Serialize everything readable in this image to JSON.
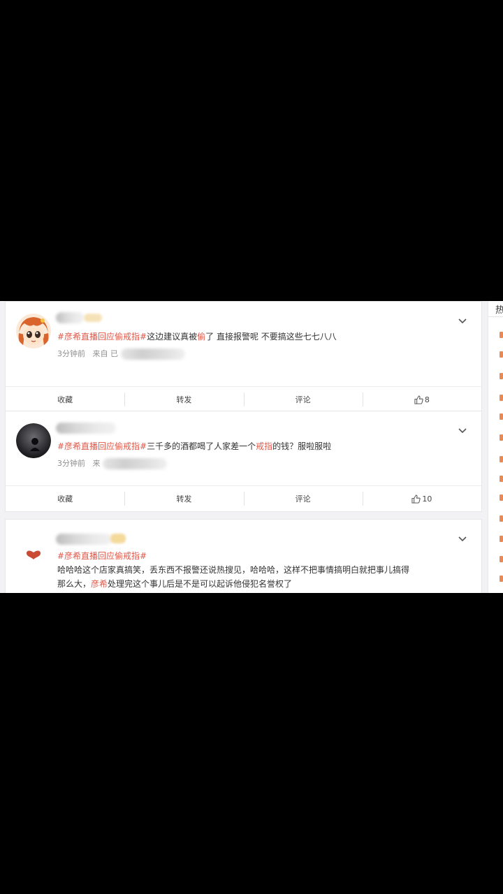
{
  "colors": {
    "topic": "#e0594a",
    "meta": "#8f8f8f",
    "background": "#f2f2f5"
  },
  "right_panel": {
    "header_char": "热"
  },
  "posts": [
    {
      "topic": "#彦希直播回应偷戒指#",
      "text_parts": [
        "这边建议真被",
        "偷",
        "了 直接报警呢 不要搞这些七七八八"
      ],
      "time": "3分钟前",
      "source_prefix": "来自 已",
      "avatar": "cartoon-girl-avatar",
      "actions": {
        "collect": "收藏",
        "repost": "转发",
        "comment": "评论",
        "likes": "8"
      }
    },
    {
      "topic": "#彦希直播回应偷戒指#",
      "text_parts": [
        "三千多的酒都喝了人家差一个",
        "戒指",
        "的钱？服啦服啦"
      ],
      "time": "3分钟前",
      "source_prefix": "来",
      "avatar": "dark-photo-avatar",
      "actions": {
        "collect": "收藏",
        "repost": "转发",
        "comment": "评论",
        "likes": "10"
      }
    },
    {
      "topic": "#彦希直播回应偷戒指#",
      "text_line1": "哈哈哈这个店家真搞笑，丢东西不报警还说热搜见，哈哈哈，这样不把事情搞明白就把事儿搞得",
      "text_line2_prefix": "那么大，",
      "text_line2_mention": "彦希",
      "text_line2_suffix": "处理完这个事儿后是不是可以起诉他侵犯名誉权了",
      "avatar": "heart-avatar"
    }
  ]
}
